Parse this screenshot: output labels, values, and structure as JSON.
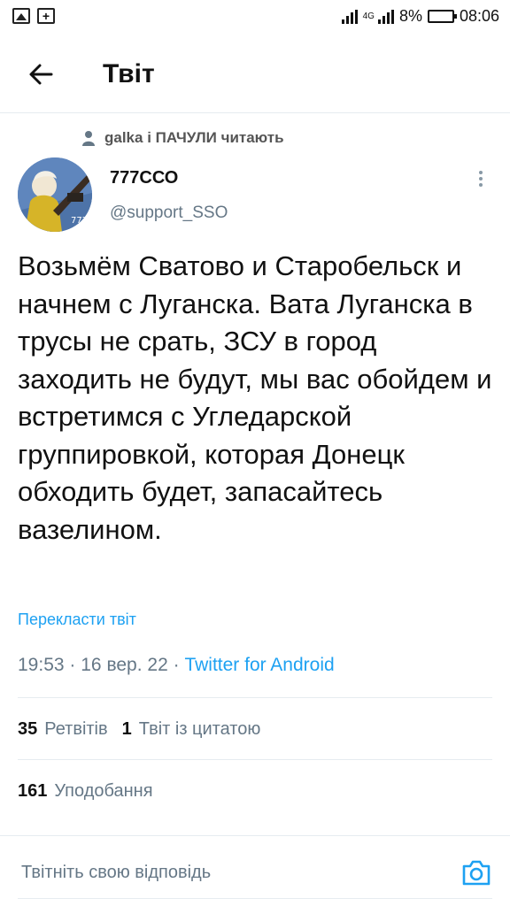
{
  "status_bar": {
    "network": "4G",
    "battery": "8%",
    "time": "08:06"
  },
  "header": {
    "title": "Твіт"
  },
  "tweet": {
    "social_context": "galka і ПАЧУЛИ читають",
    "author_name": "777ССО",
    "author_handle": "@support_SSO",
    "text": "Возьмём Сватово и Старобельск и начнем с Луганска. Вата Луганска в трусы не срать, ЗСУ в город заходить не будут, мы вас обойдем и встретимся с Угледарской группировкой, которая Донецк обходить будет, запасайтесь вазелином.",
    "translate_label": "Перекласти твіт",
    "time": "19:53",
    "date": "16 вер. 22",
    "separator": "·",
    "source": "Twitter for Android"
  },
  "stats": {
    "retweets_count": "35",
    "retweets_label": "Ретвітів",
    "quotes_count": "1",
    "quotes_label": "Твіт із цитатою",
    "likes_count": "161",
    "likes_label": "Уподобання"
  },
  "reply": {
    "placeholder": "Твітніть свою відповідь"
  },
  "colors": {
    "accent": "#1da1f2",
    "secondary_text": "#657786",
    "divider": "#e6ecf0"
  }
}
